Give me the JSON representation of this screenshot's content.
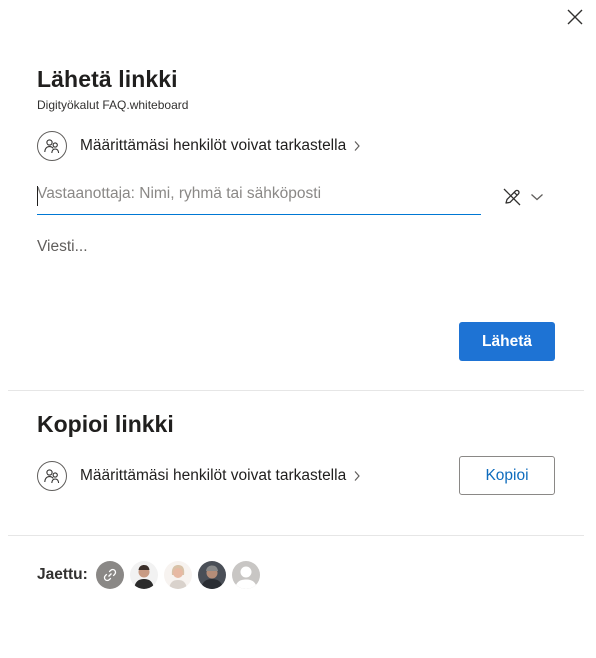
{
  "dialog": {
    "close_icon": "close-icon"
  },
  "send_link": {
    "title": "Lähetä linkki",
    "filename": "Digityökalut FAQ.whiteboard",
    "permission_label": "Määrittämäsi henkilöt voivat tarkastella",
    "recipient_placeholder": "Vastaanottaja: Nimi, ryhmä tai sähköposti",
    "recipient_value": "",
    "message_placeholder": "Viesti...",
    "send_label": "Lähetä",
    "settings_icon": "pen-off-icon"
  },
  "copy_link": {
    "title": "Kopioi linkki",
    "permission_label": "Määrittämäsi henkilöt voivat tarkastella",
    "copy_label": "Kopioi"
  },
  "shared": {
    "label": "Jaettu:",
    "avatars": [
      "link-icon",
      "avatar-1",
      "avatar-2",
      "avatar-3",
      "avatar-placeholder"
    ]
  },
  "colors": {
    "accent": "#1e73d4",
    "input_underline": "#0078d4",
    "text": "#201f1e",
    "placeholder": "#8a8886"
  }
}
